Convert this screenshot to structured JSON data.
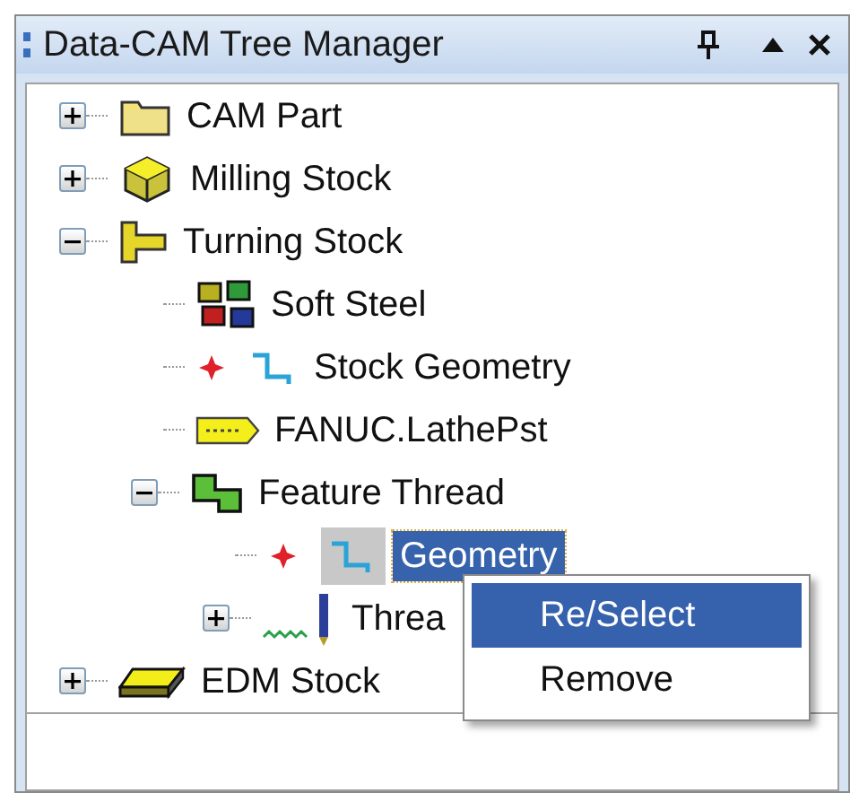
{
  "window": {
    "title": "Data-CAM Tree Manager"
  },
  "tree": [
    {
      "label": "CAM Part",
      "kind": "folder",
      "expanded": false,
      "selected": false
    },
    {
      "label": "Milling Stock",
      "kind": "cube",
      "expanded": false,
      "selected": false
    },
    {
      "label": "Turning Stock",
      "kind": "turning",
      "expanded": true,
      "selected": false,
      "children": [
        {
          "label": "Soft Steel",
          "kind": "material",
          "selected": false
        },
        {
          "label": "Stock Geometry",
          "kind": "geometry",
          "selected": false
        },
        {
          "label": "FANUC.LathePst",
          "kind": "post",
          "selected": false
        },
        {
          "label": "Feature Thread",
          "kind": "feature",
          "expanded": true,
          "selected": false,
          "children": [
            {
              "label": "Geometry",
              "kind": "geometry",
              "selected": true
            },
            {
              "label": "Threa",
              "kind": "thread",
              "expanded": false,
              "selected": false
            }
          ]
        }
      ]
    },
    {
      "label": "EDM Stock",
      "kind": "plate",
      "expanded": false,
      "selected": false
    }
  ],
  "context_menu": [
    {
      "label": "Re/Select",
      "selected": true
    },
    {
      "label": "Remove",
      "selected": false
    }
  ]
}
